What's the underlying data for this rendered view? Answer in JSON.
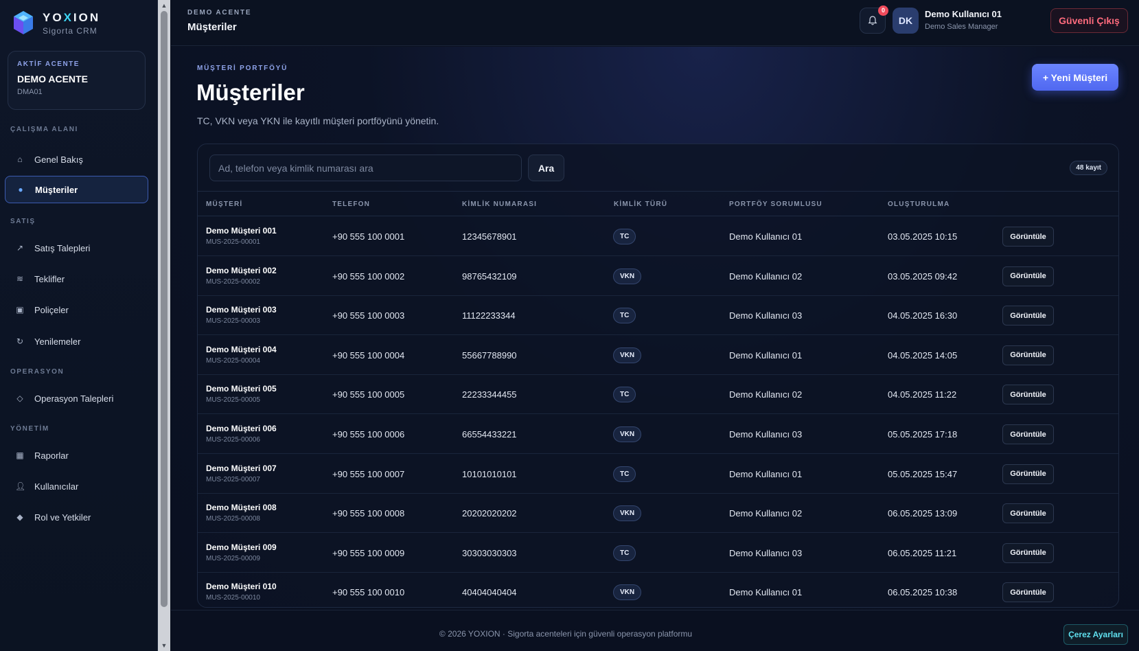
{
  "brand": {
    "name_pre": "YO",
    "name_x": "X",
    "name_post": "ION",
    "subtitle": "Sigorta CRM"
  },
  "agency": {
    "label": "AKTİF ACENTE",
    "name": "DEMO ACENTE",
    "code": "DMA01"
  },
  "nav": {
    "sections": {
      "workspace": "ÇALIŞMA ALANI",
      "sales": "SATIŞ",
      "operations": "OPERASYON",
      "management": "YÖNETİM"
    },
    "items": {
      "overview": "Genel Bakış",
      "customers": "Müşteriler",
      "sales_requests": "Satış Talepleri",
      "offers": "Teklifler",
      "policies": "Poliçeler",
      "renewals": "Yenilemeler",
      "operation_requests": "Operasyon Talepleri",
      "reports": "Raporlar",
      "users": "Kullanıcılar",
      "roles": "Rol ve Yetkiler"
    }
  },
  "header": {
    "breadcrumb": "DEMO ACENTE",
    "title": "Müşteriler",
    "notifications": "0",
    "avatar_initials": "DK",
    "user_name": "Demo Kullanıcı 01",
    "user_role": "Demo Sales Manager",
    "logout": "Güvenli Çıkış"
  },
  "page": {
    "eyebrow": "MÜŞTERİ PORTFÖYÜ",
    "title": "Müşteriler",
    "description": "TC, VKN veya YKN ile kayıtlı müşteri portföyünü yönetin.",
    "new_button": "+ Yeni Müşteri"
  },
  "search": {
    "placeholder": "Ad, telefon veya kimlik numarası ara",
    "button": "Ara",
    "count": "48 kayıt"
  },
  "table": {
    "headers": {
      "customer": "MÜŞTERİ",
      "phone": "TELEFON",
      "id_number": "KİMLİK NUMARASI",
      "id_type": "KİMLİK TÜRÜ",
      "owner": "PORTFÖY SORUMLUSU",
      "created": "OLUŞTURULMA"
    },
    "view_label": "Görüntüle",
    "rows": [
      {
        "name": "Demo Müşteri 001",
        "code": "MUS-2025-00001",
        "phone": "+90 555 100 0001",
        "id": "12345678901",
        "type": "TC",
        "owner": "Demo Kullanıcı 01",
        "created": "03.05.2025 10:15"
      },
      {
        "name": "Demo Müşteri 002",
        "code": "MUS-2025-00002",
        "phone": "+90 555 100 0002",
        "id": "98765432109",
        "type": "VKN",
        "owner": "Demo Kullanıcı 02",
        "created": "03.05.2025 09:42"
      },
      {
        "name": "Demo Müşteri 003",
        "code": "MUS-2025-00003",
        "phone": "+90 555 100 0003",
        "id": "11122233344",
        "type": "TC",
        "owner": "Demo Kullanıcı 03",
        "created": "04.05.2025 16:30"
      },
      {
        "name": "Demo Müşteri 004",
        "code": "MUS-2025-00004",
        "phone": "+90 555 100 0004",
        "id": "55667788990",
        "type": "VKN",
        "owner": "Demo Kullanıcı 01",
        "created": "04.05.2025 14:05"
      },
      {
        "name": "Demo Müşteri 005",
        "code": "MUS-2025-00005",
        "phone": "+90 555 100 0005",
        "id": "22233344455",
        "type": "TC",
        "owner": "Demo Kullanıcı 02",
        "created": "04.05.2025 11:22"
      },
      {
        "name": "Demo Müşteri 006",
        "code": "MUS-2025-00006",
        "phone": "+90 555 100 0006",
        "id": "66554433221",
        "type": "VKN",
        "owner": "Demo Kullanıcı 03",
        "created": "05.05.2025 17:18"
      },
      {
        "name": "Demo Müşteri 007",
        "code": "MUS-2025-00007",
        "phone": "+90 555 100 0007",
        "id": "10101010101",
        "type": "TC",
        "owner": "Demo Kullanıcı 01",
        "created": "05.05.2025 15:47"
      },
      {
        "name": "Demo Müşteri 008",
        "code": "MUS-2025-00008",
        "phone": "+90 555 100 0008",
        "id": "20202020202",
        "type": "VKN",
        "owner": "Demo Kullanıcı 02",
        "created": "06.05.2025 13:09"
      },
      {
        "name": "Demo Müşteri 009",
        "code": "MUS-2025-00009",
        "phone": "+90 555 100 0009",
        "id": "30303030303",
        "type": "TC",
        "owner": "Demo Kullanıcı 03",
        "created": "06.05.2025 11:21"
      },
      {
        "name": "Demo Müşteri 010",
        "code": "MUS-2025-00010",
        "phone": "+90 555 100 0010",
        "id": "40404040404",
        "type": "VKN",
        "owner": "Demo Kullanıcı 01",
        "created": "06.05.2025 10:38"
      }
    ]
  },
  "footer": {
    "copyright": "© 2026 YOXION · Sigorta acenteleri için güvenli operasyon platformu",
    "cookie": "Çerez Ayarları"
  },
  "colors": {
    "accent": "#5068f0",
    "cyan": "#3dd6f5",
    "danger": "#ff6b7d",
    "background": "#0b1120"
  }
}
